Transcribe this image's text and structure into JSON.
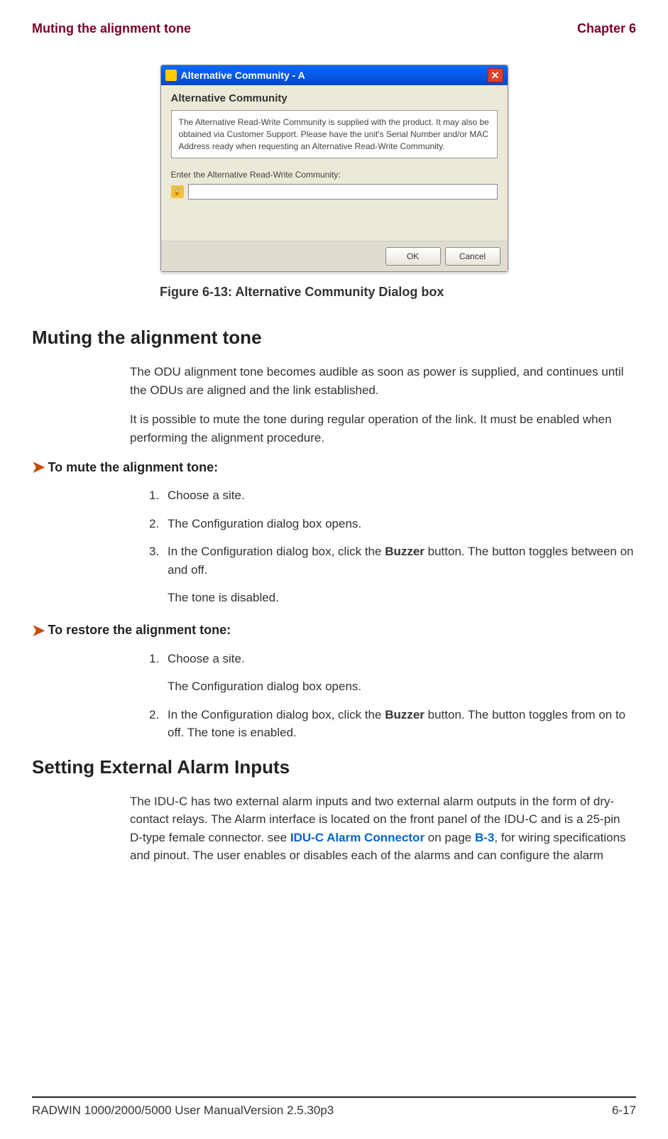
{
  "header": {
    "left": "Muting the alignment tone",
    "right": "Chapter 6"
  },
  "dialog": {
    "title": "Alternative Community - A",
    "heading": "Alternative Community",
    "info": "The Alternative Read-Write Community is supplied with the product. It may also be obtained via Customer Support. Please have the unit's Serial Number and/or MAC Address ready when requesting an Alternative Read-Write Community.",
    "field_label": "Enter the Alternative Read-Write Community:",
    "input_value": "",
    "ok": "OK",
    "cancel": "Cancel"
  },
  "figure_caption": "Figure 6-13: Alternative Community Dialog box",
  "section1": {
    "heading": "Muting the alignment tone",
    "para1": "The ODU alignment tone becomes audible as soon as power is supplied, and continues until the ODUs are aligned and the link established.",
    "para2": "It is possible to mute the tone during regular operation of the link. It must be enabled when performing the alignment procedure."
  },
  "proc1": {
    "heading": "To mute the alignment tone:",
    "steps": [
      "Choose a site.",
      "The Configuration dialog box opens.",
      "In the Configuration dialog box, click the ",
      " button. The button toggles between on and off."
    ],
    "buzzer": "Buzzer",
    "tail": "The tone is disabled."
  },
  "proc2": {
    "heading": "To restore the alignment tone:",
    "step1": "Choose a site.",
    "step1_cont": "The Configuration dialog box opens.",
    "step2_a": "In the Configuration dialog box, click the ",
    "step2_buzzer": "Buzzer",
    "step2_b": " button. The button toggles from on to off. The tone is enabled."
  },
  "section2": {
    "heading": "Setting External Alarm Inputs",
    "para_a": "The IDU-C has two external alarm inputs and two external alarm outputs in the form of dry-contact relays. The Alarm interface is located on the front panel of the IDU-C and is a 25-pin D-type female connector. see ",
    "link1": "IDU-C Alarm Connector",
    "para_b": " on page ",
    "link2": "B-3",
    "para_c": ", for wiring specifications and pinout. The user enables or disables each of the alarms and can configure the alarm"
  },
  "footer": {
    "left": "RADWIN 1000/2000/5000 User ManualVersion  2.5.30p3",
    "right": "6-17"
  }
}
